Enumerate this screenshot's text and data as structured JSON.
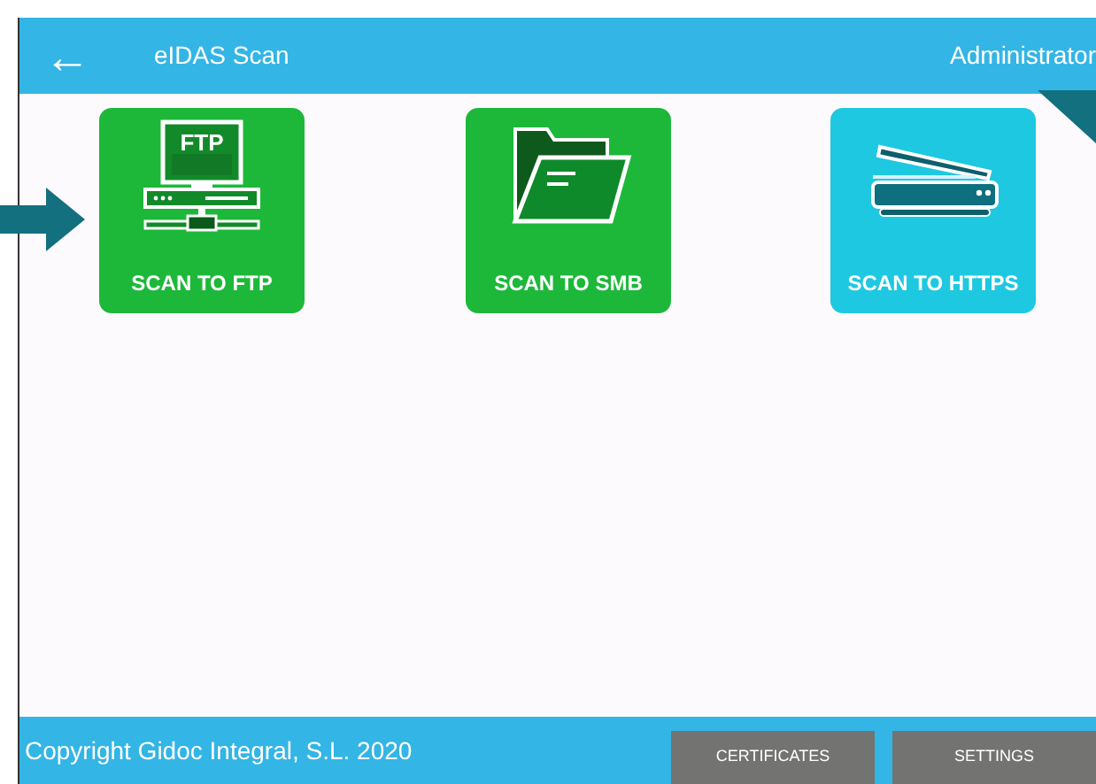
{
  "header": {
    "back": "←",
    "title": "eIDAS Scan",
    "user": "Administrator"
  },
  "tiles": [
    {
      "label": "SCAN TO FTP",
      "kind": "ftp",
      "icon_text": "FTP",
      "color": "#1db83a"
    },
    {
      "label": "SCAN TO SMB",
      "kind": "folder",
      "color": "#1db83a"
    },
    {
      "label": "SCAN TO HTTPS",
      "kind": "scanner",
      "color": "#1ec8e0"
    }
  ],
  "footer": {
    "copyright": "Copyright Gidoc Integral, S.L. 2020",
    "buttons": [
      "CERTIFICATES",
      "SETTINGS"
    ]
  }
}
